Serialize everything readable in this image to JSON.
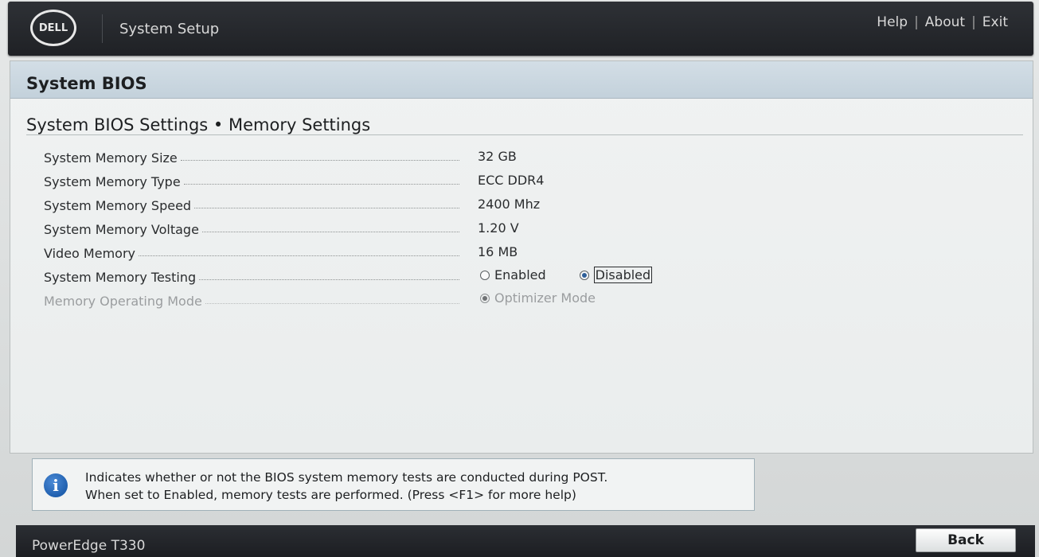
{
  "header": {
    "logo_text": "DELL",
    "title": "System Setup",
    "links": [
      "Help",
      "About",
      "Exit"
    ],
    "separator": "|"
  },
  "section": {
    "title": "System BIOS",
    "breadcrumb": "System BIOS Settings • Memory Settings"
  },
  "settings": [
    {
      "label": "System Memory Size",
      "value": "32 GB"
    },
    {
      "label": "System Memory Type",
      "value": "ECC DDR4"
    },
    {
      "label": "System Memory Speed",
      "value": "2400 Mhz"
    },
    {
      "label": "System Memory Voltage",
      "value": "1.20 V"
    },
    {
      "label": "Video Memory",
      "value": "16 MB"
    },
    {
      "label": "System Memory Testing",
      "options": [
        "Enabled",
        "Disabled"
      ],
      "selected": "Disabled"
    },
    {
      "label": "Memory Operating Mode",
      "options": [
        "Optimizer Mode"
      ],
      "selected": "Optimizer Mode",
      "disabled": true
    }
  ],
  "help": {
    "icon": "info-icon",
    "line1": "Indicates whether or not the BIOS system memory tests are conducted during POST.",
    "line2": "When set to Enabled, memory tests are performed. (Press <F1> for more help)"
  },
  "footer": {
    "model": "PowerEdge T330",
    "back_label": "Back"
  },
  "colors": {
    "header_bg": "#2e3136",
    "section_header_bg": "#c3d1db",
    "radio_selected": "#2f5f99",
    "info_icon": "#1f5fae"
  }
}
